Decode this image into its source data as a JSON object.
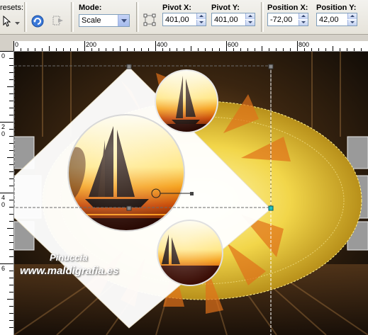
{
  "toolbar": {
    "presets_label": "resets:",
    "mode_label": "Mode:",
    "mode_value": "Scale",
    "pivot_x_label": "Pivot X:",
    "pivot_x_value": "401,00",
    "pivot_y_label": "Pivot Y:",
    "pivot_y_value": "401,00",
    "position_x_label": "Position X:",
    "position_x_value": "-72,00",
    "position_y_label": "Position Y:",
    "position_y_value": "42,00"
  },
  "rulers": {
    "h_ticks": [
      "0",
      "200",
      "400",
      "600",
      "800"
    ],
    "v_ticks": [
      "0",
      "2",
      "0",
      "4",
      "0",
      "6"
    ]
  },
  "watermark": {
    "line1": "Pinuccia",
    "line2": "www.maldigrafia.es"
  },
  "colors": {
    "toolbar_bg": "#ece9d8",
    "accent_blue": "#7f9db9",
    "canvas_dark": "#2a1c10",
    "gold": "#e8c22a",
    "sunset_orange": "#f08a10"
  }
}
